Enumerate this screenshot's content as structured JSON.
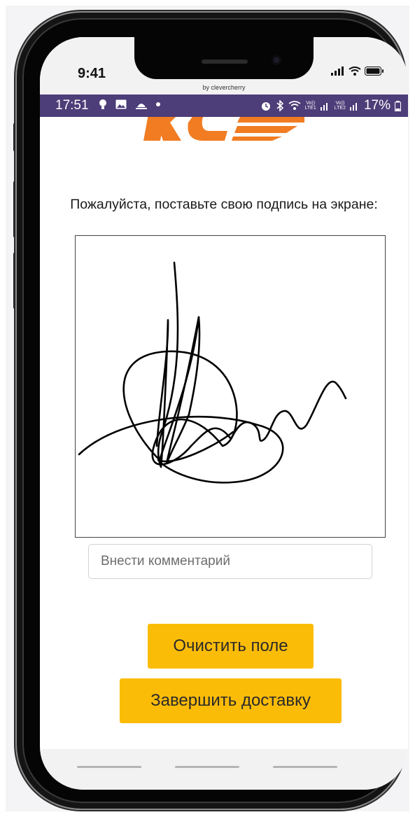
{
  "ios_status": {
    "time": "9:41",
    "byline": "by clevercherry"
  },
  "android_status": {
    "time": "17:51",
    "lte1": "Vo))\nLTE1",
    "lte2": "Vo))\nLTE2",
    "battery": "17%"
  },
  "logo": {
    "brand_color": "#f17c22"
  },
  "form": {
    "prompt": "Пожалуйста, поставьте свою подпись на экране:",
    "comment_placeholder": "Внести комментарий",
    "comment_value": ""
  },
  "buttons": {
    "clear_label": "Очистить поле",
    "finish_label": "Завершить доставку",
    "color": "#fbbc08"
  },
  "colors": {
    "android_bar": "#4d3d78",
    "phone_frame": "#141414"
  }
}
